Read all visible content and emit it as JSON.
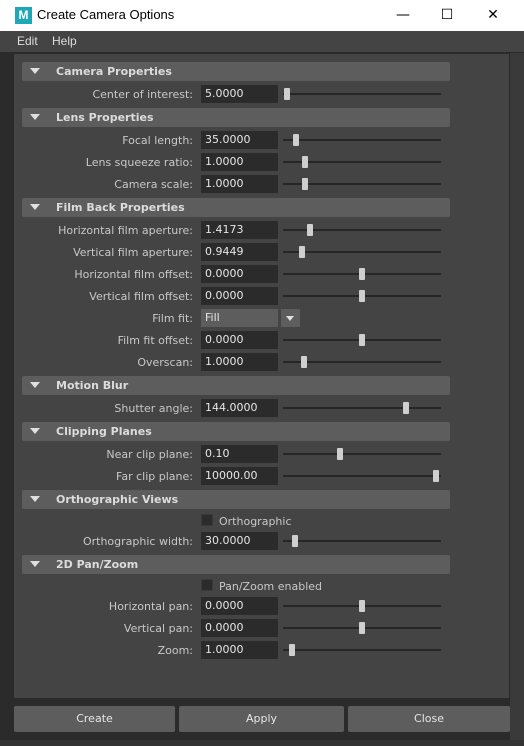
{
  "window": {
    "title": "Create Camera Options",
    "icon": "maya-m-icon",
    "icon_letter": "M",
    "minimize": "—",
    "maximize": "☐",
    "close": "✕"
  },
  "menu": [
    "Edit",
    "Help"
  ],
  "sections": {
    "camera": {
      "title": "Camera Properties",
      "center_of_interest": {
        "label": "Center of interest:",
        "value": "5.0000",
        "slider": 0.0
      }
    },
    "lens": {
      "title": "Lens Properties",
      "focal_length": {
        "label": "Focal length:",
        "value": "35.0000",
        "slider": 0.06
      },
      "lens_squeeze_ratio": {
        "label": "Lens squeeze ratio:",
        "value": "1.0000",
        "slider": 0.12
      },
      "camera_scale": {
        "label": "Camera scale:",
        "value": "1.0000",
        "slider": 0.12
      }
    },
    "film_back": {
      "title": "Film Back Properties",
      "horizontal_film_aperture": {
        "label": "Horizontal film aperture:",
        "value": "1.4173",
        "slider": 0.15
      },
      "vertical_film_aperture": {
        "label": "Vertical film aperture:",
        "value": "0.9449",
        "slider": 0.1
      },
      "horizontal_film_offset": {
        "label": "Horizontal film offset:",
        "value": "0.0000",
        "slider": 0.5
      },
      "vertical_film_offset": {
        "label": "Vertical film offset:",
        "value": "0.0000",
        "slider": 0.5
      },
      "film_fit": {
        "label": "Film fit:",
        "value": "Fill"
      },
      "film_fit_offset": {
        "label": "Film fit offset:",
        "value": "0.0000",
        "slider": 0.5
      },
      "overscan": {
        "label": "Overscan:",
        "value": "1.0000",
        "slider": 0.11
      }
    },
    "motion_blur": {
      "title": "Motion Blur",
      "shutter_angle": {
        "label": "Shutter angle:",
        "value": "144.0000",
        "slider": 0.79
      }
    },
    "clipping": {
      "title": "Clipping Planes",
      "near_clip_plane": {
        "label": "Near clip plane:",
        "value": "0.10",
        "slider": 0.35
      },
      "far_clip_plane": {
        "label": "Far clip plane:",
        "value": "10000.00",
        "slider": 0.99
      }
    },
    "orthographic": {
      "title": "Orthographic Views",
      "orthographic_checkbox": {
        "label": "Orthographic",
        "checked": false
      },
      "orthographic_width": {
        "label": "Orthographic width:",
        "value": "30.0000",
        "slider": 0.05
      }
    },
    "pan_zoom": {
      "title": "2D Pan/Zoom",
      "pan_zoom_enabled": {
        "label": "Pan/Zoom enabled",
        "checked": false
      },
      "horizontal_pan": {
        "label": "Horizontal pan:",
        "value": "0.0000",
        "slider": 0.5
      },
      "vertical_pan": {
        "label": "Vertical pan:",
        "value": "0.0000",
        "slider": 0.5
      },
      "zoom": {
        "label": "Zoom:",
        "value": "1.0000",
        "slider": 0.03
      }
    }
  },
  "buttons": {
    "create": "Create",
    "apply": "Apply",
    "close": "Close"
  },
  "colors": {
    "panel": "#444444",
    "header": "#5d5d5d",
    "field": "#2b2b2b",
    "accent": "#1fa7b8"
  }
}
